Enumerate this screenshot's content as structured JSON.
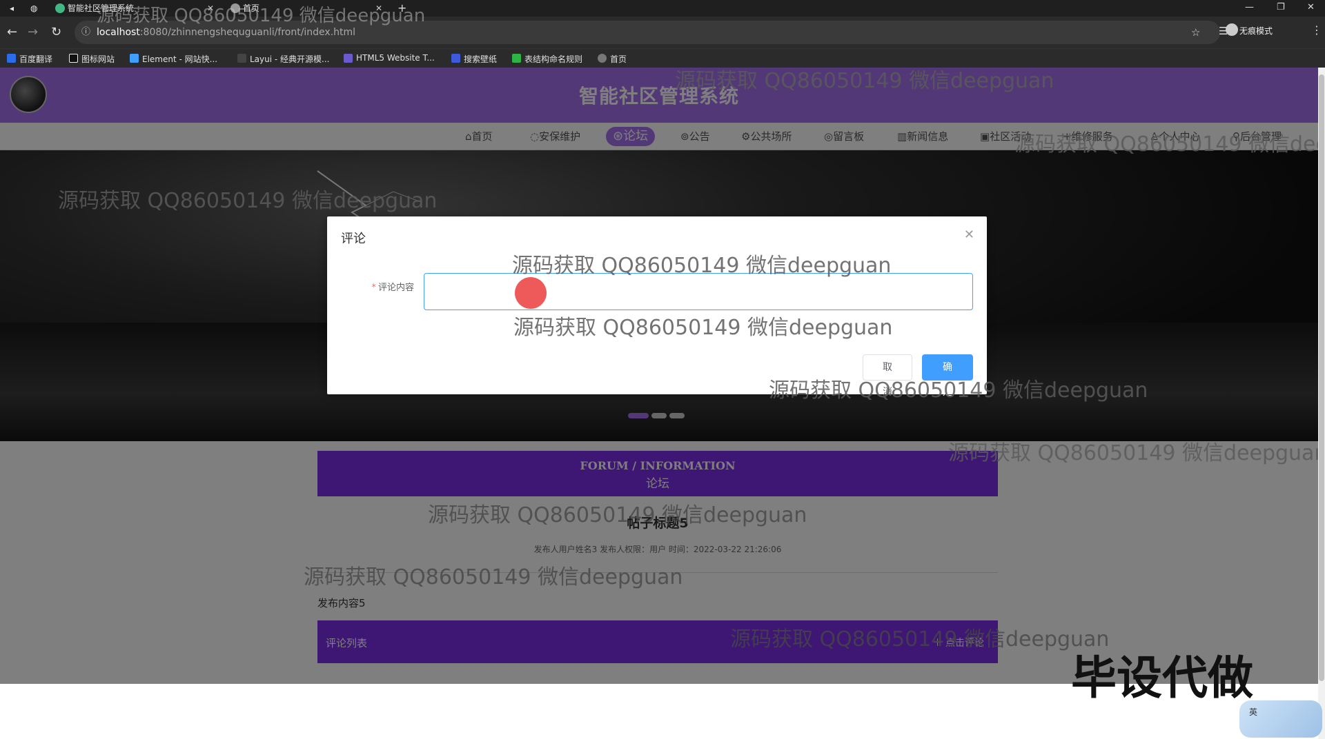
{
  "browser": {
    "tabs": [
      {
        "label": "智能社区管理系统"
      },
      {
        "label": "首页"
      }
    ],
    "url_host": "localhost",
    "url_path": ":8080/zhinnengshequguanli/front/index.html",
    "incognito_label": "无痕模式",
    "bookmarks": [
      {
        "label": "百度翻译"
      },
      {
        "label": "图标网站"
      },
      {
        "label": "Element - 网站快..."
      },
      {
        "label": "Layui - 经典开源模..."
      },
      {
        "label": "HTML5 Website T..."
      },
      {
        "label": "搜索壁纸"
      },
      {
        "label": "表结构命名规则"
      },
      {
        "label": "首页"
      }
    ]
  },
  "site": {
    "title": "智能社区管理系统",
    "nav": [
      {
        "label": "首页",
        "icon": "home-icon"
      },
      {
        "label": "安保维护",
        "icon": "shield-icon"
      },
      {
        "label": "论坛",
        "icon": "forum-icon",
        "active": true
      },
      {
        "label": "公告",
        "icon": "notice-icon"
      },
      {
        "label": "公共场所",
        "icon": "place-icon"
      },
      {
        "label": "留言板",
        "icon": "message-icon"
      },
      {
        "label": "新闻信息",
        "icon": "news-icon"
      },
      {
        "label": "社区活动",
        "icon": "activity-icon"
      },
      {
        "label": "维修服务",
        "icon": "repair-icon"
      },
      {
        "label": "个人中心",
        "icon": "user-icon"
      },
      {
        "label": "后台管理",
        "icon": "admin-icon"
      }
    ]
  },
  "forum": {
    "heading_en": "FORUM / INFORMATION",
    "heading_zh": "论坛",
    "post_title": "帖子标题5",
    "post_meta": "发布人用户姓名3   发布人权限：用户   时间：2022-03-22 21:26:06",
    "post_content": "发布内容5",
    "comments_label": "评论列表",
    "add_comment_label": "点击评论"
  },
  "dialog": {
    "title": "评论",
    "field_label": "评论内容",
    "field_value": "",
    "cancel_label": "取 消",
    "confirm_label": "确 定"
  },
  "watermarks": {
    "text": "源码获取 QQ86050149 微信deepguan",
    "promo": "毕设代做"
  },
  "ime": {
    "label": "英"
  },
  "colors": {
    "header_purple": "#a770ef",
    "forum_purple": "#7a2ee6",
    "primary_blue": "#409eff"
  }
}
